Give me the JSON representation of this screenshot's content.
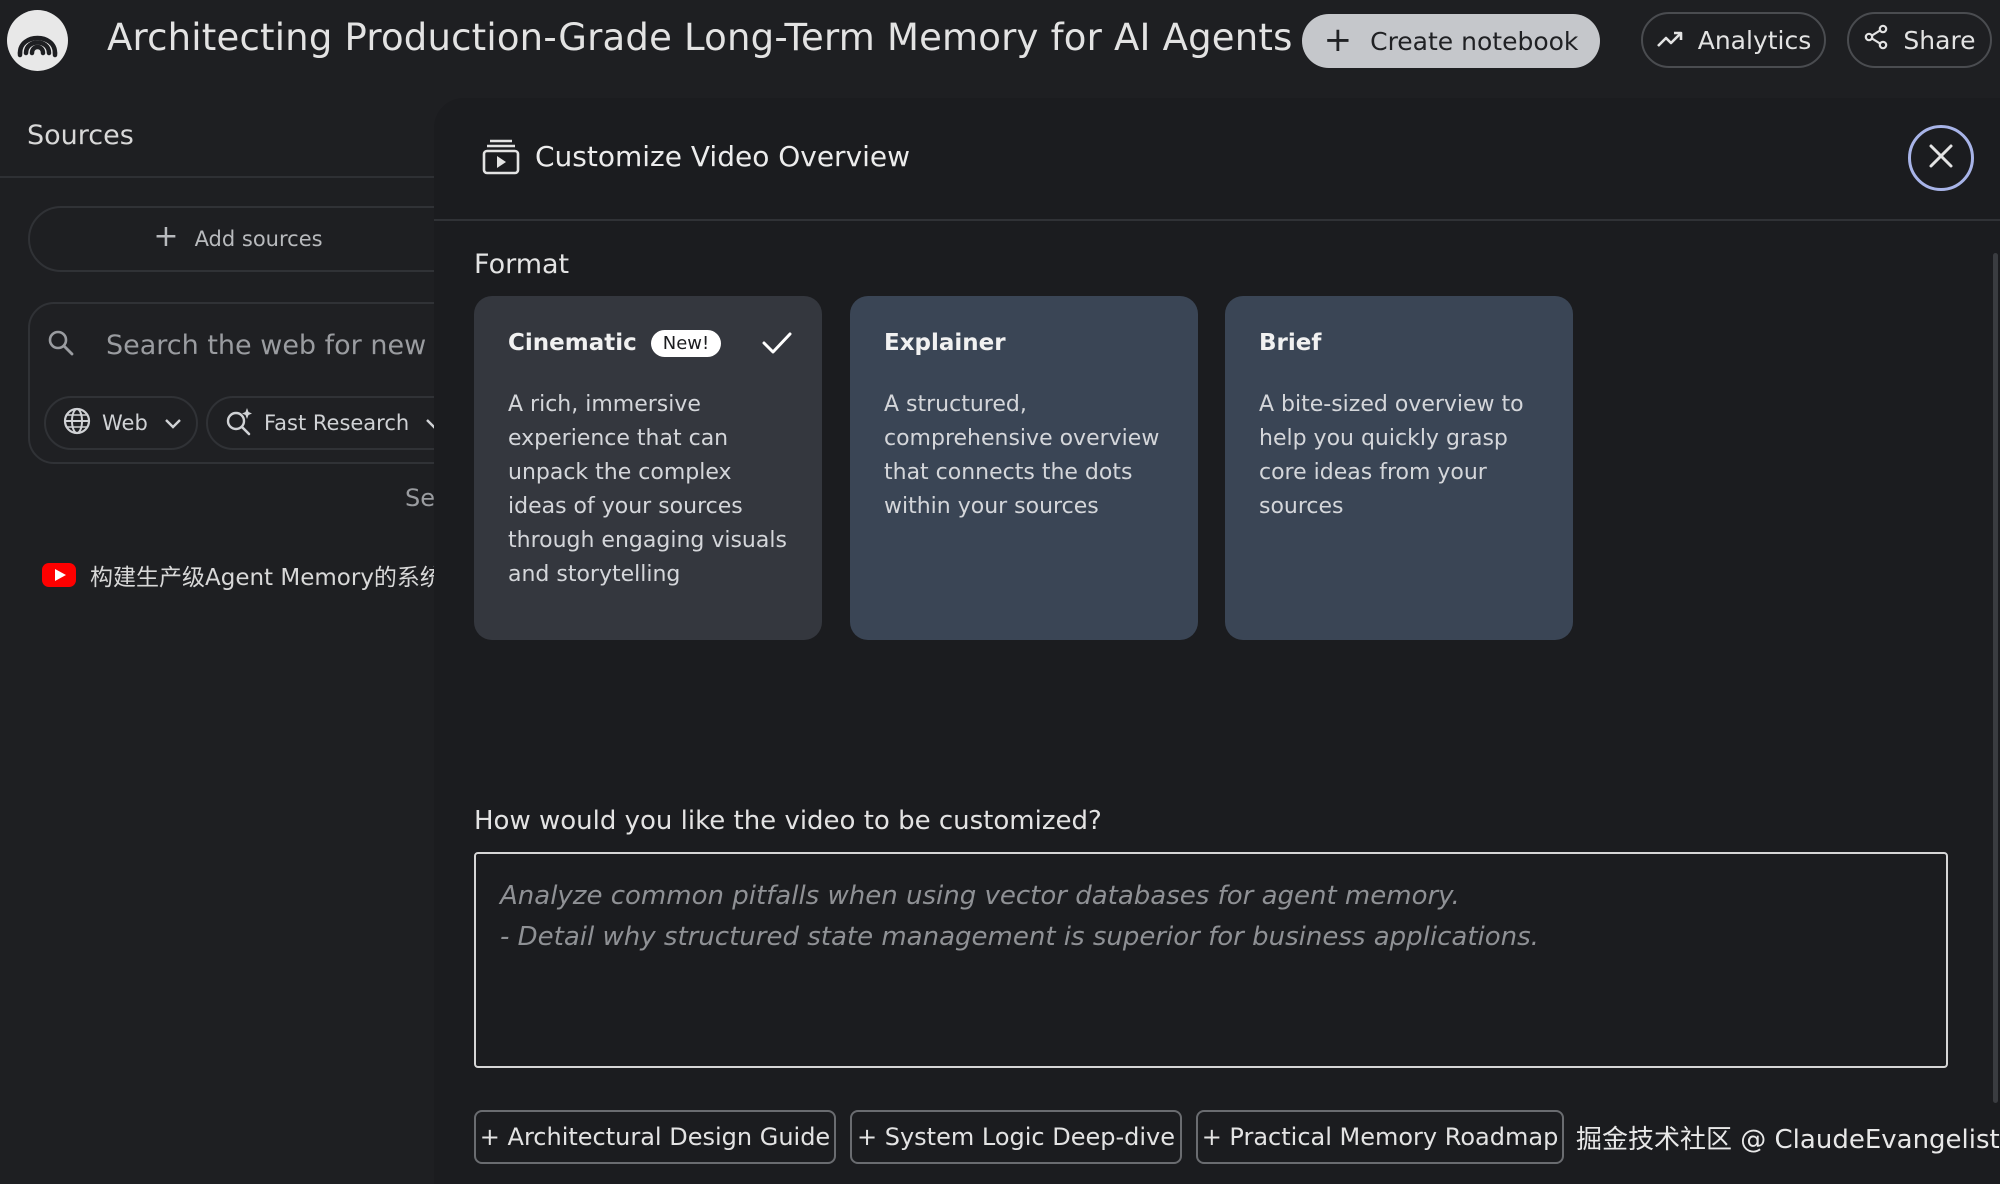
{
  "header": {
    "title": "Architecting Production-Grade Long-Term Memory for AI Agents",
    "create_notebook_label": "Create notebook",
    "analytics_label": "Analytics",
    "share_label": "Share"
  },
  "sidebar": {
    "title": "Sources",
    "add_sources_label": "Add sources",
    "search_placeholder": "Search the web for new so",
    "web_chip_label": "Web",
    "research_chip_label": "Fast Research",
    "partial_text": "Se",
    "sources": [
      {
        "title": "构建生产级Agent Memory的系统",
        "icon": "youtube-icon"
      }
    ]
  },
  "modal": {
    "title": "Customize Video Overview",
    "format_label": "Format",
    "formats": [
      {
        "name": "Cinematic",
        "badge": "New!",
        "selected": true,
        "description": "A rich, immersive experience that can unpack the complex ideas of your sources through engaging visuals and storytelling"
      },
      {
        "name": "Explainer",
        "selected": false,
        "description": "A structured, comprehensive overview that connects the dots within your sources"
      },
      {
        "name": "Brief",
        "selected": false,
        "description": "A bite-sized overview to help you quickly grasp core ideas from your sources"
      }
    ],
    "customize_question": "How would you like the video to be customized?",
    "placeholder_line1": "Analyze common pitfalls when using vector databases for agent memory.",
    "placeholder_line2": "- Detail why structured state management is superior for business applications.",
    "suggestions": [
      "+ Architectural Design Guide",
      "+ System Logic Deep-dive",
      "+ Practical Memory Roadmap"
    ],
    "watermark": "掘金技术社区 @ ClaudeEvangelist"
  },
  "colors": {
    "background": "#1e1f22",
    "card_unselected": "#3a4555",
    "card_selected": "#34373e",
    "close_ring": "#a8b4e8"
  }
}
